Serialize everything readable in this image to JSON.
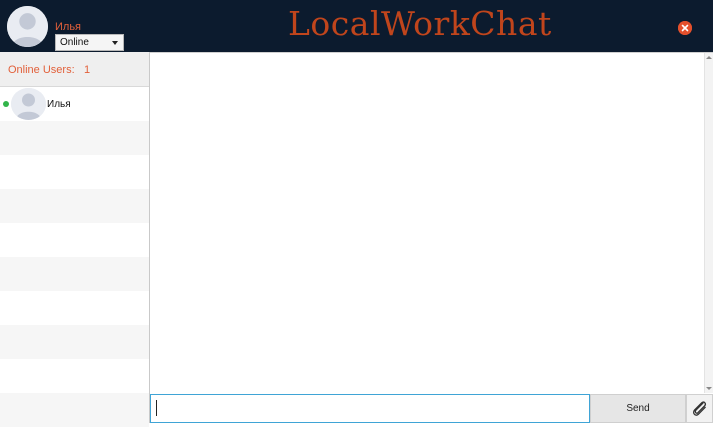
{
  "header": {
    "username": "Илья",
    "status_selected": "Online",
    "app_title": "LocalWorkChat",
    "close_icon": "close-icon",
    "avatar_icon": "avatar-placeholder-icon"
  },
  "sidebar": {
    "online_users_label": "Online Users:",
    "online_users_count": "1",
    "users": [
      {
        "name": "Илья",
        "status": "online"
      }
    ]
  },
  "composer": {
    "input_value": "",
    "send_label": "Send",
    "attach_icon": "paperclip-icon"
  },
  "colors": {
    "header_bg": "#0c1b2e",
    "accent": "#e2603a",
    "title": "#c0451c",
    "online_dot": "#32b44a",
    "input_border": "#3fa4d6"
  }
}
